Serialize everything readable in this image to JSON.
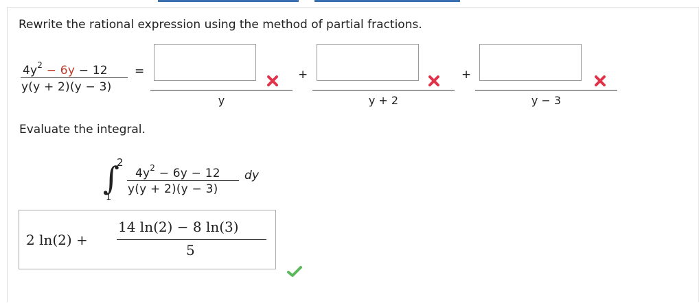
{
  "question": {
    "instruction": "Rewrite the rational expression using the method of partial fractions.",
    "lhs": {
      "num_a": "4y",
      "num_exp": "2",
      "num_minus1": "−",
      "num_b": "6y",
      "num_minus2": "−",
      "num_c": "12",
      "den": "y(y + 2)(y − 3)"
    },
    "equals": "=",
    "plus": "+",
    "terms": [
      {
        "numerator_value": "",
        "denominator": "y",
        "status": "incorrect"
      },
      {
        "numerator_value": "",
        "denominator": "y + 2",
        "status": "incorrect"
      },
      {
        "numerator_value": "",
        "denominator": "y − 3",
        "status": "incorrect"
      }
    ]
  },
  "integral": {
    "instruction": "Evaluate the integral.",
    "upper": "2",
    "lower": "1",
    "integrand_num_a": "4y",
    "integrand_exp": "2",
    "integrand_num_b": "− 6y − 12",
    "integrand_den": "y(y + 2)(y − 3)",
    "differential": "dy",
    "answer": {
      "lead": "2 ln(2) +",
      "frac_num": "14 ln(2) − 8 ln(3)",
      "frac_den": "5"
    },
    "status": "correct"
  },
  "colors": {
    "incorrect": "#e0334a",
    "correct": "#5cb85c",
    "accent": "#3a6fb0"
  },
  "icons": {
    "incorrect": "x-mark-icon",
    "correct": "checkmark-icon"
  }
}
